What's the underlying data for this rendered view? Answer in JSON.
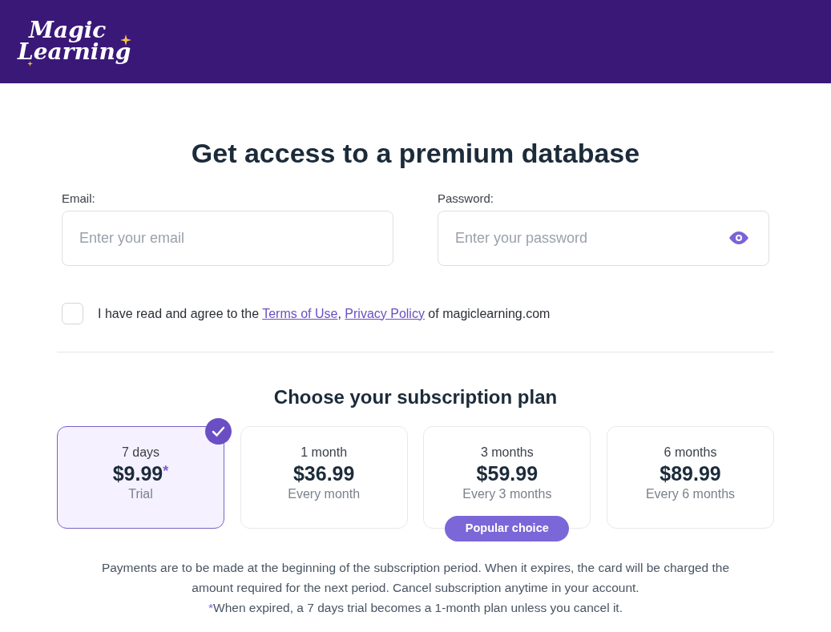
{
  "header": {
    "logo": {
      "line_1": "Magic",
      "line_2": "Learning"
    }
  },
  "title": "Get access to a premium database",
  "fields": [
    {
      "kind": "text",
      "label": "Email:",
      "placeholder": "Enter your email"
    },
    {
      "kind": "password",
      "label": "Password:",
      "placeholder": "Enter your password"
    }
  ],
  "agreement": {
    "checked": false,
    "parts": [
      {
        "kind": "text",
        "text": "I have read and agree to the "
      },
      {
        "kind": "link",
        "text": "Terms of Use"
      },
      {
        "kind": "text",
        "text": ", "
      },
      {
        "kind": "link",
        "text": "Privacy Policy"
      },
      {
        "kind": "text",
        "text": " of magiclearning.com"
      }
    ]
  },
  "plans_title": "Choose your subscription plan",
  "plans": [
    {
      "period": "7 days",
      "price": "$9.99",
      "price_mark": "*",
      "billing": "Trial",
      "selected": true
    },
    {
      "period": "1 month",
      "price": "$36.99",
      "billing": "Every month",
      "selected": false
    },
    {
      "period": "3 months",
      "price": "$59.99",
      "billing": "Every 3 months",
      "badge": "Popular choice",
      "selected": false
    },
    {
      "period": "6 months",
      "price": "$89.99",
      "billing": "Every 6 months",
      "selected": false
    }
  ],
  "note": "Payments are to be made at the beginning of the subscription period. When it expires, the card will be charged the amount required for the next period. Cancel subscription anytime in your account.",
  "footnote": {
    "mark": "*",
    "text": "When expired, a 7 days trial becomes a 1-month plan unless you cancel it."
  }
}
